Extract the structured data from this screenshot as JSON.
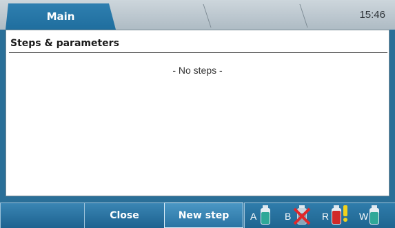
{
  "tabs": [
    {
      "label": "Main",
      "active": true
    },
    {
      "label": "",
      "active": false
    },
    {
      "label": "",
      "active": false
    }
  ],
  "clock": "15:46",
  "panel": {
    "title": "Steps & parameters",
    "empty_message": "- No steps -"
  },
  "toolbar": {
    "buttons": [
      {
        "label": ""
      },
      {
        "label": "Close"
      },
      {
        "label": "New step"
      }
    ]
  },
  "bottles": [
    {
      "letter": "A",
      "icon": "bottle-teal-icon",
      "color": "#2fa898"
    },
    {
      "letter": "B",
      "icon": "bottle-missing-icon",
      "color": "#8aa6b8",
      "crossed": true
    },
    {
      "letter": "R",
      "icon": "bottle-red-warning-icon",
      "color": "#d02a2a",
      "warning": true
    },
    {
      "letter": "W",
      "icon": "bottle-teal-icon",
      "color": "#2fa898"
    }
  ],
  "colors": {
    "accent": "#2a6f98",
    "tab_bar": "#c2ccd3"
  }
}
